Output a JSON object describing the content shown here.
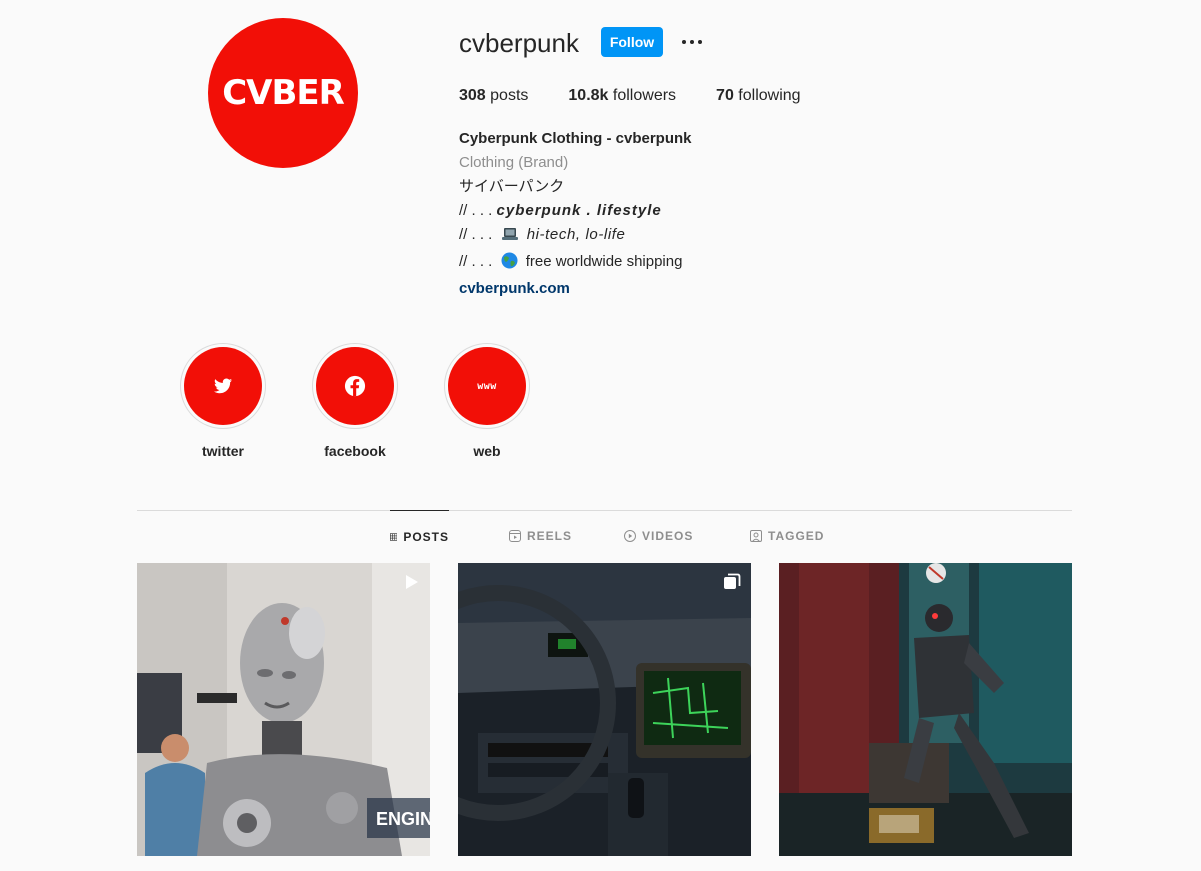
{
  "profile": {
    "avatar_text": "CVBER",
    "username": "cvberpunk",
    "follow_label": "Follow"
  },
  "stats": {
    "posts_count": "308",
    "posts_label": "posts",
    "followers_count": "10.8k",
    "followers_label": "followers",
    "following_count": "70",
    "following_label": "following"
  },
  "bio": {
    "name": "Cyberpunk Clothing - cvberpunk",
    "category": "Clothing (Brand)",
    "japanese": "サイバーパンク",
    "line1_prefix": "// . . .",
    "line1_text": "cyberpunk . lifestyle",
    "line2_prefix": "// . . .",
    "line2_text": "hi-tech, lo-life",
    "line3_prefix": "// . . .",
    "line3_text": "free worldwide shipping",
    "link": "cvberpunk.com"
  },
  "highlights": [
    {
      "label": "twitter",
      "icon": "twitter-icon"
    },
    {
      "label": "facebook",
      "icon": "facebook-icon"
    },
    {
      "label": "web",
      "icon": "www-icon",
      "icon_text": "www"
    }
  ],
  "tabs": [
    {
      "label": "POSTS",
      "icon": "grid-icon",
      "active": true
    },
    {
      "label": "REELS",
      "icon": "reels-icon",
      "active": false
    },
    {
      "label": "VIDEOS",
      "icon": "video-icon",
      "active": false
    },
    {
      "label": "TAGGED",
      "icon": "tagged-icon",
      "active": false
    }
  ],
  "posts": [
    {
      "type": "video",
      "overlay_text": "ENGIN"
    },
    {
      "type": "carousel"
    },
    {
      "type": "image"
    }
  ],
  "colors": {
    "brand_red": "#f20f07",
    "follow_blue": "#0095f6",
    "link_blue": "#00376b"
  }
}
